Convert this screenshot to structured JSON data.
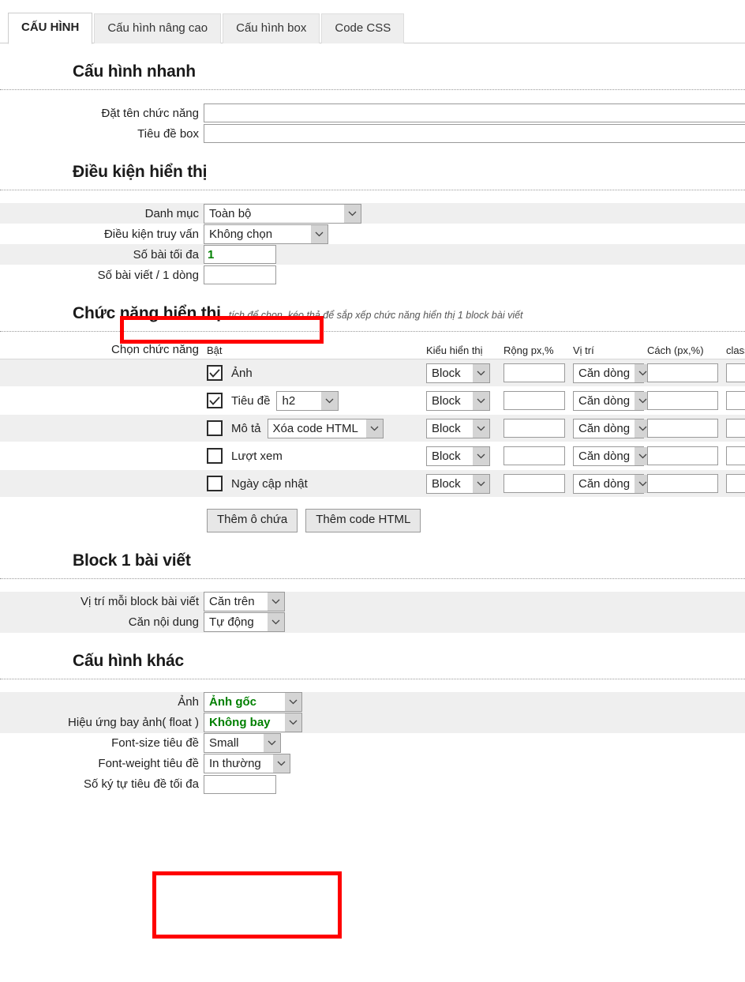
{
  "tabs": [
    {
      "label": "CẤU HÌNH",
      "active": true
    },
    {
      "label": "Cấu hình nâng cao",
      "active": false
    },
    {
      "label": "Cấu hình box",
      "active": false
    },
    {
      "label": "Code CSS",
      "active": false
    }
  ],
  "colors": {
    "highlight_box": "#ff0000",
    "green_value": "#008000",
    "row_stripe": "#efefef",
    "tab_inactive_bg": "#eeeeee"
  },
  "sections": {
    "quick_config": {
      "title": "Cấu hình nhanh",
      "rows": [
        {
          "label": "Đặt tên chức năng",
          "value": "",
          "placeholder": ""
        },
        {
          "label": "Tiêu đề box",
          "value": "",
          "placeholder": ""
        }
      ]
    },
    "display_condition": {
      "title": "Điều kiện hiển thị",
      "rows": [
        {
          "label": "Danh mục",
          "type": "select",
          "value": "Toàn bộ"
        },
        {
          "label": "Điều kiện truy vấn",
          "type": "select",
          "value": "Không chọn"
        },
        {
          "label": "Số bài tối đa",
          "type": "text",
          "value": "1",
          "highlighted": true
        },
        {
          "label": "Số bài viết / 1 dòng",
          "type": "text",
          "value": ""
        }
      ]
    },
    "display_functions": {
      "title": "Chức năng hiển thị",
      "note": "tích để chọn, kéo thả để sắp xếp chức năng hiển thị 1 block bài viết",
      "row_label": "Chọn chức năng",
      "columns": [
        "Bật",
        "Kiểu hiển thị",
        "Rộng px,%",
        "Vị trí",
        "Cách (px,%)",
        "class"
      ],
      "rows": [
        {
          "checked": true,
          "name": "Ảnh",
          "sub_select": null,
          "kieu": "Block",
          "rong": "",
          "vitri": "Căn dòng",
          "cach": "",
          "class": ""
        },
        {
          "checked": true,
          "name": "Tiêu đề",
          "sub_select": "h2",
          "kieu": "Block",
          "rong": "",
          "vitri": "Căn dòng",
          "cach": "",
          "class": ""
        },
        {
          "checked": false,
          "name": "Mô tả",
          "sub_select": "Xóa code HTML",
          "kieu": "Block",
          "rong": "",
          "vitri": "Căn dòng",
          "cach": "",
          "class": ""
        },
        {
          "checked": false,
          "name": "Lượt xem",
          "sub_select": null,
          "kieu": "Block",
          "rong": "",
          "vitri": "Căn dòng",
          "cach": "",
          "class": ""
        },
        {
          "checked": false,
          "name": "Ngày cập nhật",
          "sub_select": null,
          "kieu": "Block",
          "rong": "",
          "vitri": "Căn dòng",
          "cach": "",
          "class": ""
        }
      ],
      "buttons": [
        {
          "label": "Thêm ô chứa"
        },
        {
          "label": "Thêm code HTML"
        }
      ]
    },
    "block_one_post": {
      "title": "Block 1 bài viết",
      "rows": [
        {
          "label": "Vị trí mỗi block bài viết",
          "type": "select",
          "value": "Căn trên"
        },
        {
          "label": "Căn nội dung",
          "type": "select",
          "value": "Tự động"
        }
      ]
    },
    "other_config": {
      "title": "Cấu hình khác",
      "rows": [
        {
          "label": "Ảnh",
          "type": "select",
          "value": "Ảnh gốc",
          "green": true,
          "highlighted": true
        },
        {
          "label": "Hiệu ứng bay ảnh( float )",
          "type": "select",
          "value": "Không bay",
          "green": true,
          "highlighted": true
        },
        {
          "label": "Font-size tiêu đề",
          "type": "select",
          "value": "Small"
        },
        {
          "label": "Font-weight tiêu đề",
          "type": "select",
          "value": "In thường"
        },
        {
          "label": "Số ký tự tiêu đề tối đa",
          "type": "text",
          "value": ""
        }
      ]
    }
  }
}
